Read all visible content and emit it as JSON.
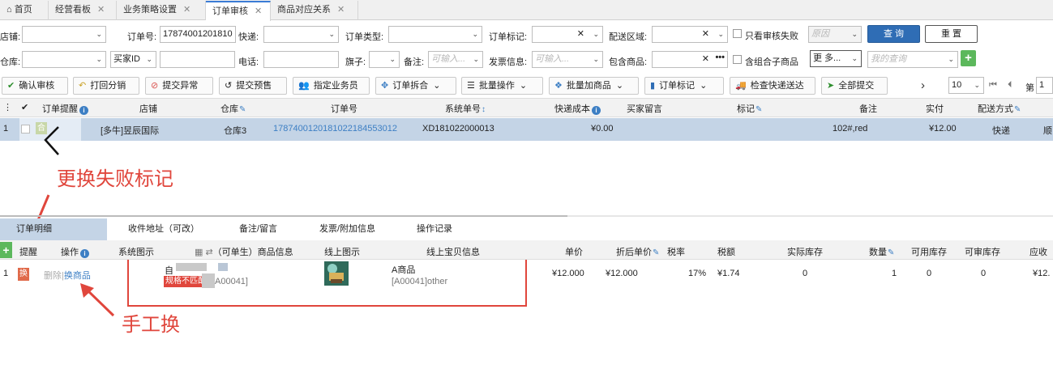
{
  "tabs": [
    {
      "label": "首页",
      "icon": "home-icon"
    },
    {
      "label": "经营看板"
    },
    {
      "label": "业务策略设置"
    },
    {
      "label": "订单审核"
    },
    {
      "label": "商品对应关系"
    }
  ],
  "filters": {
    "shop_label": "店铺:",
    "order_no_label": "订单号:",
    "order_no_value": "17874001201810",
    "express_label": "快递:",
    "order_type_label": "订单类型:",
    "order_mark_label": "订单标记:",
    "delivery_area_label": "配送区域:",
    "only_fail_label": "只看审核失败",
    "reason_placeholder": "原因",
    "query_button": "查 询",
    "reset_button": "重 置",
    "warehouse_label": "仓库:",
    "buyer_id_select": "买家ID",
    "phone_label": "电话:",
    "flag_label": "旗子:",
    "remark_label": "备注:",
    "remark_placeholder": "可输入...",
    "invoice_label": "发票信息:",
    "invoice_placeholder": "可输入...",
    "contains_goods_label": "包含商品:",
    "combo_label": "含组合子商品",
    "more_button": "更 多...",
    "my_query_placeholder": "我的查询"
  },
  "toolbar": {
    "confirm": "确认审核",
    "split_back": "打回分销",
    "submit_exception": "提交异常",
    "submit_presale": "提交预售",
    "assign_salesman": "指定业务员",
    "order_split": "订单拆合",
    "batch_ops": "批量操作",
    "batch_add_goods": "批量加商品",
    "order_mark": "订单标记",
    "check_express": "检查快递送达",
    "submit_all": "全部提交",
    "next_arrow": "›",
    "page_size": "10",
    "first_icon": "⏮",
    "prev_icon": "⏴",
    "page_prefix": "第",
    "page_value": "1"
  },
  "grid": {
    "headers": [
      "订单提醒",
      "店铺",
      "仓库",
      "订单号",
      "系统单号",
      "快递成本",
      "买家留言",
      "标记",
      "备注",
      "实付",
      "配送方式"
    ],
    "row": {
      "index": "1",
      "badge": "合",
      "shop": "[多牛]昱辰国际",
      "warehouse": "仓库3",
      "order_no": "178740012018102218455301 2",
      "system_no": "XD181022000013",
      "express_cost": "¥0.00",
      "remark": "102#,red",
      "paid": "¥12.00",
      "delivery": "快递",
      "overflow": "顺"
    }
  },
  "annotations": {
    "top": "更换失败标记",
    "bottom": "手工换"
  },
  "detail_tabs": [
    "订单明细",
    "收件地址（可改）",
    "备注/留言",
    "发票/附加信息",
    "操作记录"
  ],
  "detail": {
    "headers": [
      "提醒",
      "操作",
      "系统图示",
      "（可单生）商品信息",
      "线上图示",
      "线上宝贝信息",
      "单价",
      "折后单价",
      "税率",
      "税额",
      "实际库存",
      "数量",
      "可用库存",
      "可审库存",
      "应收"
    ],
    "row": {
      "index": "1",
      "badge": "换",
      "delete": "删除",
      "replace": "换商品",
      "goods_name": "自",
      "spec_badge": "规格不匹配",
      "goods_code": "A00041]",
      "online_name": "A商品",
      "online_code": "[A00041]other",
      "price": "¥12.000",
      "discount_price": "¥12.000",
      "tax_rate": "17%",
      "tax": "¥1.74",
      "actual_stock": "0",
      "qty": "1",
      "available": "0",
      "auditable": "0",
      "receivable": "¥12."
    }
  },
  "colors": {
    "accent": "#2f6db5",
    "selected_row": "#c4d4e6",
    "annotation": "#e0463c",
    "link": "#3d7fc4"
  }
}
